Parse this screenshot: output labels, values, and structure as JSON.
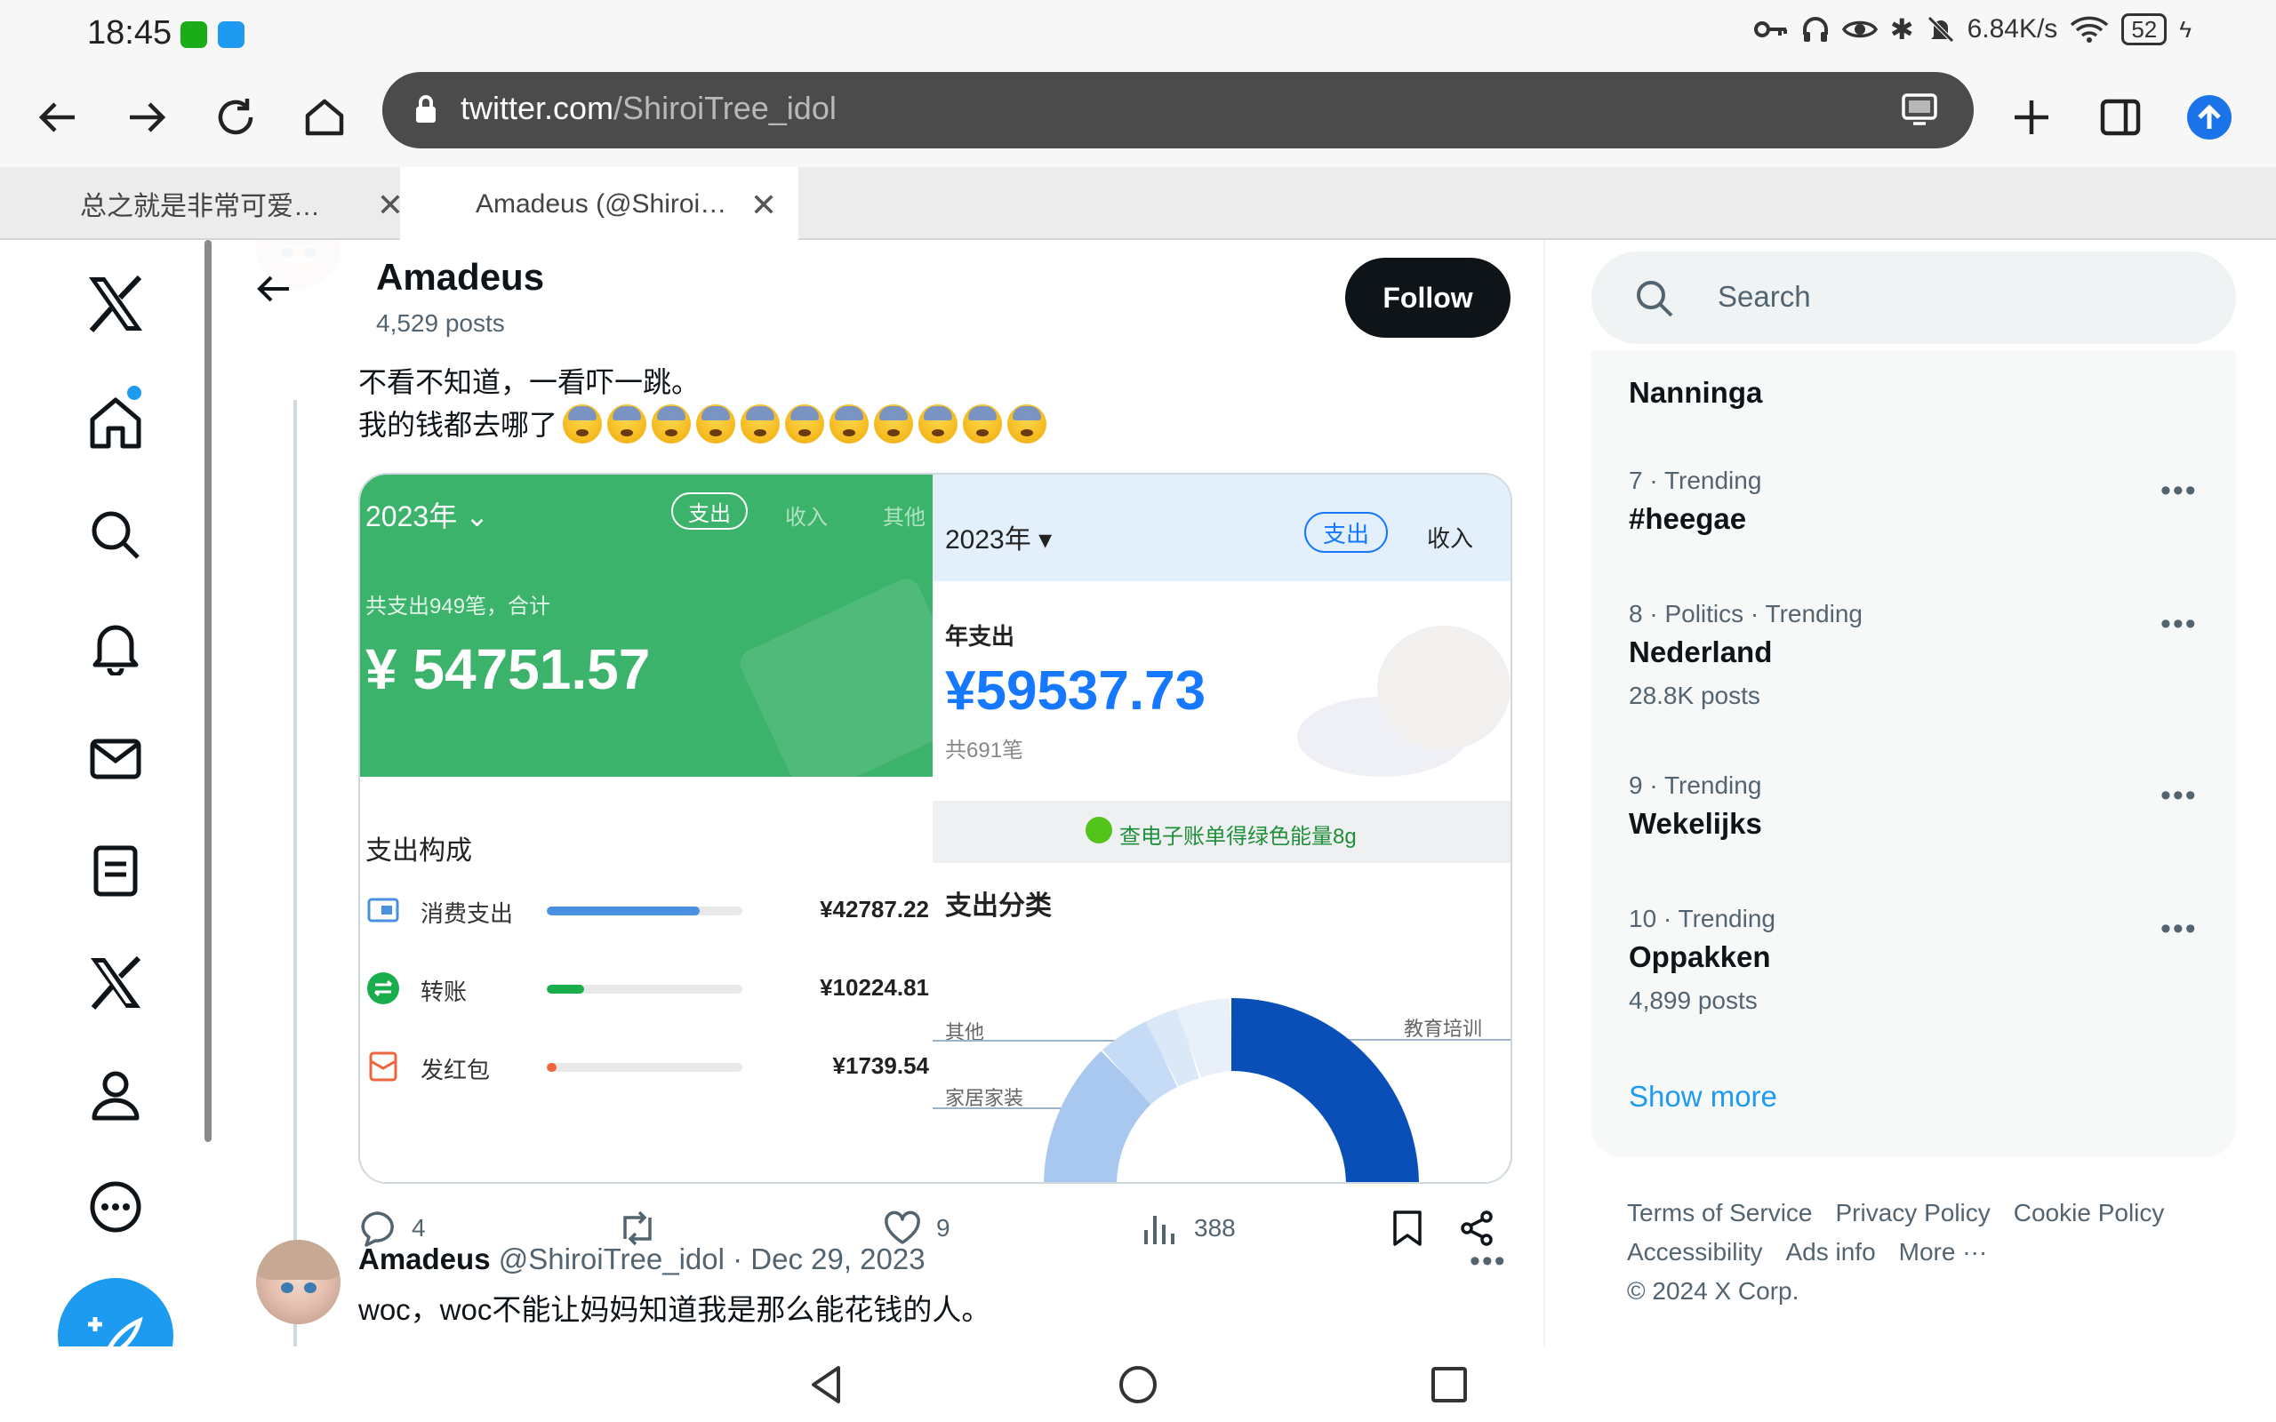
{
  "status_bar": {
    "time": "18:45",
    "net_speed": "6.84K/s",
    "battery": "52",
    "icons": [
      "wechat-icon",
      "app-icon",
      "key-icon",
      "headphones-icon",
      "eye-icon",
      "bluetooth-icon",
      "mute-icon",
      "wifi-icon",
      "battery-icon"
    ]
  },
  "browser": {
    "url_host": "twitter.com",
    "url_path": "/ShiroiTree_idol",
    "tabs": [
      {
        "label": "总之就是非常可爱…"
      },
      {
        "label": "Amadeus (@Shiroi…"
      }
    ]
  },
  "header": {
    "name": "Amadeus",
    "posts": "4,529 posts",
    "follow": "Follow"
  },
  "tweet1": {
    "line1": "不看不知道，一看吓一跳。",
    "line2": "我的钱都去哪了",
    "emoji_count": 11,
    "stats": {
      "replies": "4",
      "likes": "9",
      "views": "388"
    }
  },
  "media": {
    "left": {
      "year": "2023年",
      "tab_active": "支出",
      "tab_income": "收入",
      "tab_other": "其他",
      "subtitle": "共支出949笔，合计",
      "amount": "¥ 54751.57",
      "section_title": "支出构成",
      "rows": [
        {
          "label": "消费支出",
          "value": "¥42787.22",
          "fraction": 0.78,
          "color": "#4a90e2"
        },
        {
          "label": "转账",
          "value": "¥10224.81",
          "fraction": 0.19,
          "color": "#1aad4b"
        },
        {
          "label": "发红包",
          "value": "¥1739.54",
          "fraction": 0.05,
          "color": "#f0643c"
        }
      ]
    },
    "right": {
      "year": "2023年",
      "tab_active": "支出",
      "tab_income": "收入",
      "label": "年支出",
      "amount": "¥59537.73",
      "count": "共691笔",
      "band_text": "查电子账单得绿色能量8g",
      "section_title": "支出分类",
      "legend": [
        "其他",
        "家居家装",
        "教育培训"
      ]
    }
  },
  "tweet2": {
    "name": "Amadeus",
    "handle": "@ShiroiTree_idol · Dec 29, 2023",
    "text": "woc，woc不能让妈妈知道我是那么能花钱的人。"
  },
  "search": {
    "placeholder": "Search"
  },
  "trends": {
    "partial_name": "Nanninga",
    "items": [
      {
        "meta": "7 · Trending",
        "name": "#heegae",
        "posts": ""
      },
      {
        "meta": "8 · Politics · Trending",
        "name": "Nederland",
        "posts": "28.8K posts"
      },
      {
        "meta": "9 · Trending",
        "name": "Wekelijks",
        "posts": ""
      },
      {
        "meta": "10 · Trending",
        "name": "Oppakken",
        "posts": "4,899 posts"
      }
    ],
    "show_more": "Show more"
  },
  "footer": {
    "links": [
      "Terms of Service",
      "Privacy Policy",
      "Cookie Policy",
      "Accessibility",
      "Ads info",
      "More ···"
    ],
    "copyright": "© 2024 X Corp."
  },
  "colors": {
    "accent": "#1d9bf0",
    "alipay_blue": "#1677ff",
    "wechat_green": "#3bb36a"
  }
}
